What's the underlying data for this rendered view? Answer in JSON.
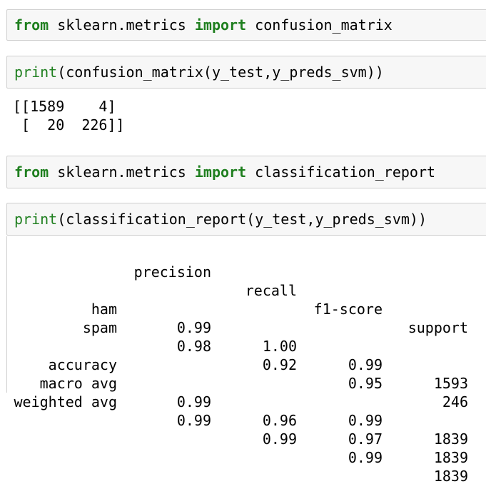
{
  "cells": [
    {
      "tokens": [
        {
          "text": "from",
          "style": "kw-green"
        },
        {
          "text": " sklearn.metrics ",
          "style": "plain"
        },
        {
          "text": "import",
          "style": "kw-green"
        },
        {
          "text": " confusion_matrix",
          "style": "plain"
        }
      ]
    },
    {
      "tokens": [
        {
          "text": "print",
          "style": "kw-green-normal"
        },
        {
          "text": "(confusion_matrix(y_test,y_preds_svm))",
          "style": "plain"
        }
      ]
    },
    {
      "tokens": [
        {
          "text": "from",
          "style": "kw-green"
        },
        {
          "text": " sklearn.metrics ",
          "style": "plain"
        },
        {
          "text": "import",
          "style": "kw-green"
        },
        {
          "text": " classification_report",
          "style": "plain"
        }
      ]
    },
    {
      "tokens": [
        {
          "text": "print",
          "style": "kw-green-normal"
        },
        {
          "text": "(classification_report(y_test,y_preds_svm))",
          "style": "plain"
        }
      ]
    }
  ],
  "confusion_output": {
    "line1": "[[1589    4]",
    "line2": " [  20  226]]"
  },
  "report": {
    "headers": [
      "precision",
      "recall",
      "f1-score",
      "support"
    ],
    "rows": [
      {
        "label": "ham",
        "precision": "0.99",
        "recall": "1.00",
        "f1": "0.99",
        "support": "1593"
      },
      {
        "label": "spam",
        "precision": "0.98",
        "recall": "0.92",
        "f1": "0.95",
        "support": "246"
      },
      {
        "label": "accuracy",
        "precision": "",
        "recall": "",
        "f1": "0.99",
        "support": "1839"
      },
      {
        "label": "macro avg",
        "precision": "0.99",
        "recall": "0.96",
        "f1": "0.97",
        "support": "1839"
      },
      {
        "label": "weighted avg",
        "precision": "0.99",
        "recall": "0.99",
        "f1": "0.99",
        "support": "1839"
      }
    ]
  }
}
